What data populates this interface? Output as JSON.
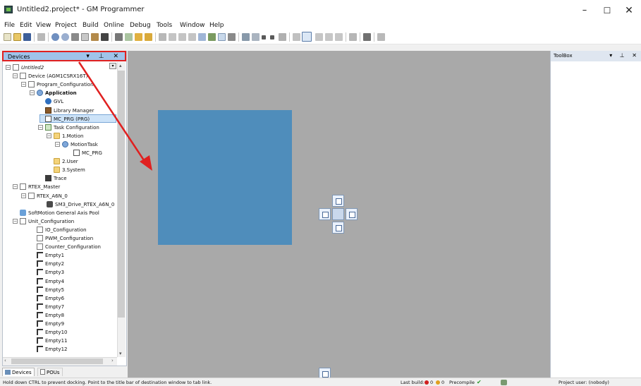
{
  "window": {
    "title": "Untitled2.project* - GM Programmer",
    "min_glyph": "–",
    "max_glyph": "☐",
    "close_glyph": "✕"
  },
  "menu": [
    "File",
    "Edit",
    "View",
    "Project",
    "Build",
    "Online",
    "Debug",
    "Tools",
    "Window",
    "Help"
  ],
  "devices_panel": {
    "title": "Devices",
    "header_buttons": "▾ ⊥ ✕",
    "tree": [
      {
        "label": "Untitled2",
        "icon": "project-icon"
      },
      {
        "label": "Device (AGM1CSRX16T)",
        "icon": "device-icon"
      },
      {
        "label": "Program_Configuration",
        "icon": "program-config-icon"
      },
      {
        "label": "Application",
        "icon": "application-gear-icon"
      },
      {
        "label": "GVL",
        "icon": "globe-icon"
      },
      {
        "label": "Library Manager",
        "icon": "library-icon"
      },
      {
        "label": "MC_PRG (PRG)",
        "icon": "pou-icon"
      },
      {
        "label": "Task Configuration",
        "icon": "task-config-icon"
      },
      {
        "label": "1.Motion",
        "icon": "folder-icon"
      },
      {
        "label": "MotionTask",
        "icon": "task-icon"
      },
      {
        "label": "MC_PRG",
        "icon": "pou-icon"
      },
      {
        "label": "2.User",
        "icon": "folder-icon"
      },
      {
        "label": "3.System",
        "icon": "folder-icon"
      },
      {
        "label": "Trace",
        "icon": "trace-icon"
      },
      {
        "label": "RTEX_Master",
        "icon": "device-icon"
      },
      {
        "label": "RTEX_A6N_0",
        "icon": "device-icon"
      },
      {
        "label": "SM3_Drive_RTEX_A6N_0",
        "icon": "drive-icon"
      },
      {
        "label": "SoftMotion General Axis Pool",
        "icon": "axis-pool-icon"
      },
      {
        "label": "Unit_Configuration",
        "icon": "device-icon"
      },
      {
        "label": "IO_Configuration",
        "icon": "device-icon"
      },
      {
        "label": "PWM_Configuration",
        "icon": "device-icon"
      },
      {
        "label": "Counter_Configuration",
        "icon": "device-icon"
      },
      {
        "label": "Empty1",
        "icon": "empty-slot-icon"
      },
      {
        "label": "Empty2",
        "icon": "empty-slot-icon"
      },
      {
        "label": "Empty3",
        "icon": "empty-slot-icon"
      },
      {
        "label": "Empty4",
        "icon": "empty-slot-icon"
      },
      {
        "label": "Empty5",
        "icon": "empty-slot-icon"
      },
      {
        "label": "Empty6",
        "icon": "empty-slot-icon"
      },
      {
        "label": "Empty7",
        "icon": "empty-slot-icon"
      },
      {
        "label": "Empty8",
        "icon": "empty-slot-icon"
      },
      {
        "label": "Empty9",
        "icon": "empty-slot-icon"
      },
      {
        "label": "Empty10",
        "icon": "empty-slot-icon"
      },
      {
        "label": "Empty11",
        "icon": "empty-slot-icon"
      },
      {
        "label": "Empty12",
        "icon": "empty-slot-icon"
      }
    ],
    "tabs": {
      "devices": "Devices",
      "pous": "POUs"
    }
  },
  "toolbox": {
    "title": "ToolBox",
    "header_buttons": "▾ ⊥ ✕"
  },
  "status": {
    "hint": "Hold down CTRL to prevent docking. Point to the title bar of destination window to tab link.",
    "last_build_label": "Last build:",
    "errors": "0",
    "warnings": "0",
    "precompile_label": "Precompile",
    "precompile_check": "✔",
    "project_user": "Project user: (nobody)"
  },
  "colors": {
    "highlight": "#e02020",
    "dock_preview": "#4f8dbb",
    "workspace": "#a9a9a9",
    "panel_header_active": "#9fc3ea"
  }
}
